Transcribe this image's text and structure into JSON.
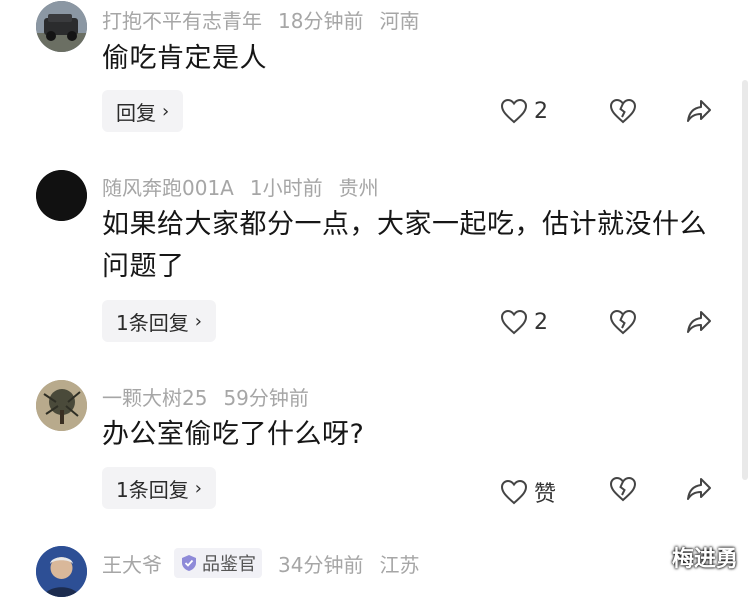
{
  "comments": [
    {
      "username": "打抱不平有志青年",
      "time": "18分钟前",
      "location": "河南",
      "text": "偷吃肯定是人",
      "reply_label": "回复",
      "likes": "2",
      "avatar_icon": "car-photo-avatar"
    },
    {
      "username": "随风奔跑001A",
      "time": "1小时前",
      "location": "贵州",
      "text": "如果给大家都分一点，大家一起吃，估计就没什么问题了",
      "reply_label": "1条回复",
      "likes": "2",
      "avatar_icon": "black-circle-avatar"
    },
    {
      "username": "一颗大树25",
      "time": "59分钟前",
      "text": "办公室偷吃了什么呀?",
      "reply_label": "1条回复",
      "likes": "赞",
      "avatar_icon": "tree-photo-avatar"
    },
    {
      "username": "王大爷",
      "badge": "品鉴官",
      "time": "34分钟前",
      "location": "江苏",
      "avatar_icon": "elder-man-photo-avatar"
    }
  ],
  "watermark": "梅进勇",
  "colors": {
    "meta_gray": "#a6a6a6",
    "text": "#161616",
    "pill_bg": "#f3f3f5",
    "badge_check": "#8e8ad8"
  }
}
